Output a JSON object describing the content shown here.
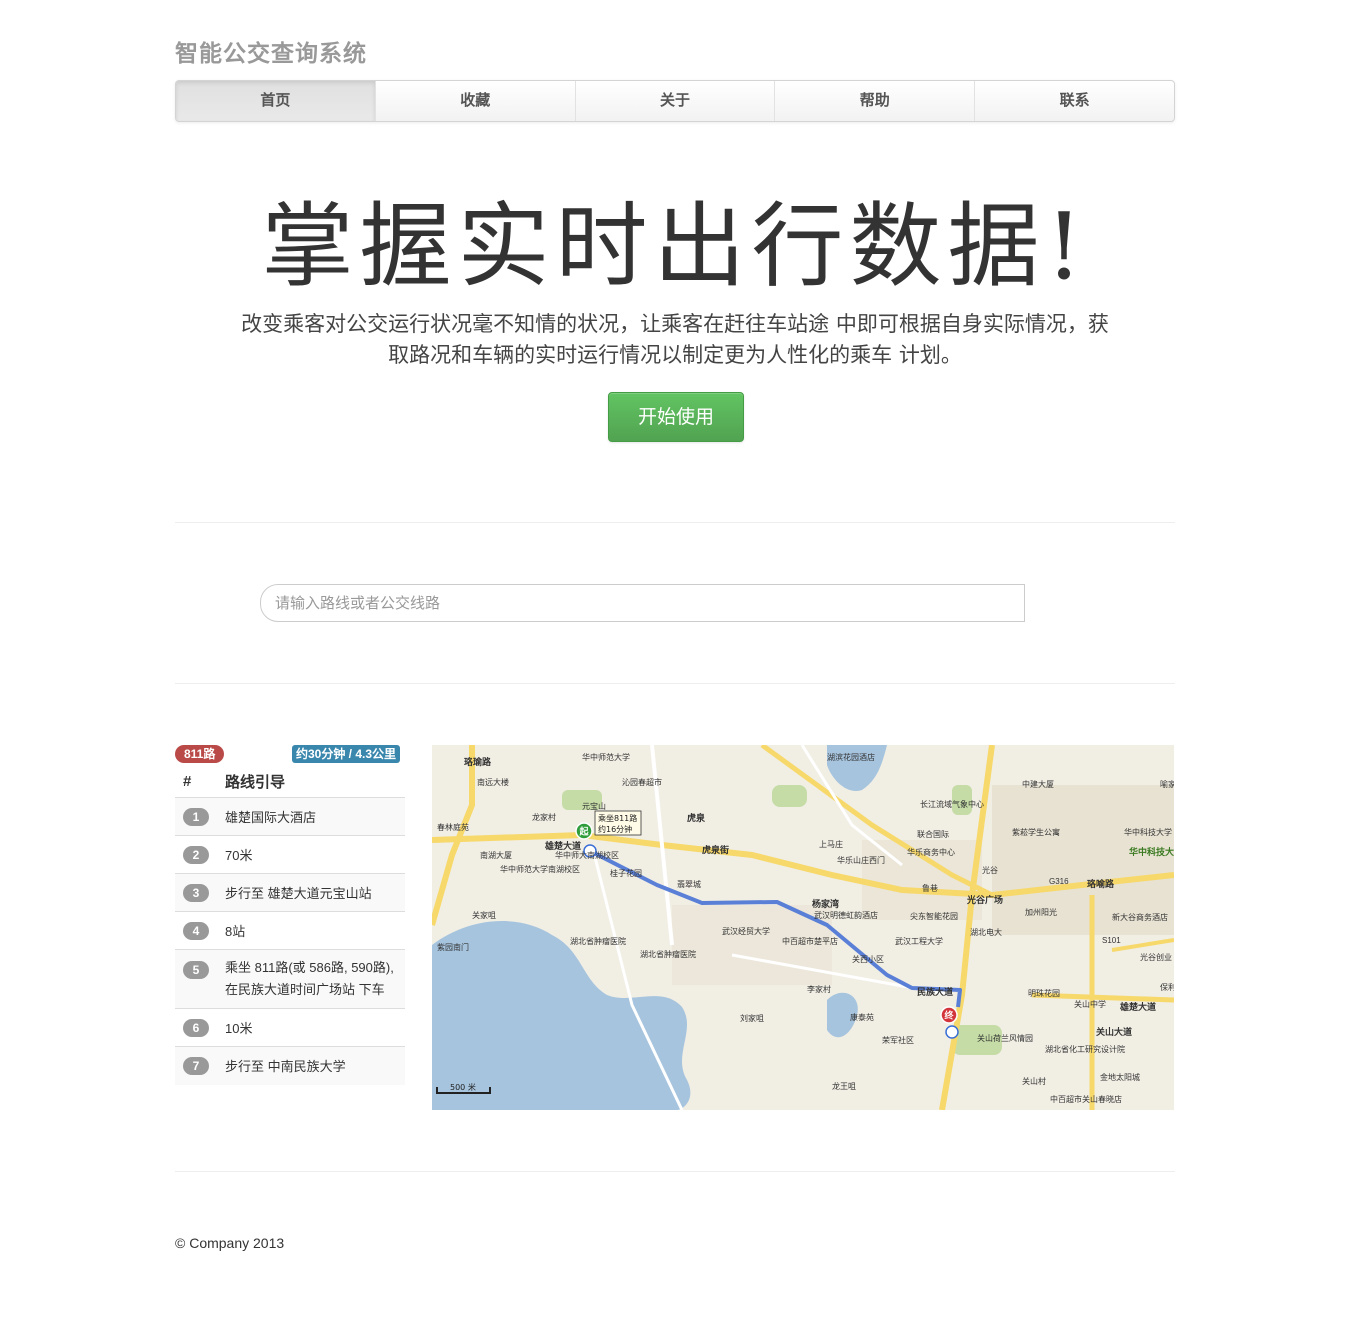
{
  "brand": "智能公交查询系统",
  "nav": {
    "items": [
      "首页",
      "收藏",
      "关于",
      "帮助",
      "联系"
    ],
    "active_index": 0
  },
  "hero": {
    "title": "掌握实时出行数据!",
    "lead_line1": "改变乘客对公交运行状况毫不知情的状况，让乘客在赶往车站途 中即可根据自身实际情况，获",
    "lead_line2": "取路况和车辆的实时运行情况以制定更为人性化的乘车 计划。",
    "start_button": "开始使用"
  },
  "search": {
    "placeholder": "请输入路线或者公交线路",
    "value": ""
  },
  "route": {
    "badge": "811路",
    "time_label": "约30分钟 / 4.3公里",
    "col_num": "#",
    "col_title": "路线引导",
    "steps": [
      {
        "num": "1",
        "text": "雄楚国际大酒店"
      },
      {
        "num": "2",
        "text": "70米"
      },
      {
        "num": "3",
        "text": "步行至 雄楚大道元宝山站"
      },
      {
        "num": "4",
        "text": "8站"
      },
      {
        "num": "5",
        "text": "乘坐 811路(或 586路, 590路), 在民族大道时间广场站 下车"
      },
      {
        "num": "6",
        "text": "10米"
      },
      {
        "num": "7",
        "text": "步行至 中南民族大学"
      }
    ]
  },
  "map": {
    "callout_line1": "乘坐811路",
    "callout_line2": "约16分钟",
    "start_marker": "起",
    "end_marker": "终",
    "scale": "500 米",
    "labels": [
      "华中师范大学",
      "南远大楼",
      "沁园春超市",
      "虎泉",
      "湖滨花园酒店",
      "中建大厦",
      "喻家",
      "华中科技大学",
      "华中科技大",
      "春林庭苑",
      "龙家村",
      "元宝山",
      "南湖大厦",
      "华中师大南湖校区",
      "华中师范大学南湖校区",
      "桂子花园",
      "翡翠城",
      "杨家湾",
      "武汉明德虹韵酒店",
      "武汉经贸大学",
      "中百超市楚平店",
      "关西小区",
      "武汉工程大学",
      "湖北电大",
      "光谷广场",
      "光谷",
      "鲁巷",
      "尖东智能花园",
      "华乐山庄西门",
      "华乐商务中心",
      "联合国际",
      "长江流域气象中心",
      "紫菘学生公寓",
      "加州阳光",
      "新大谷商务酒店",
      "光谷创业",
      "关家咀",
      "紫园南门",
      "湖北省肿瘤医院",
      "湖北省肿瘤医院",
      "李家村",
      "刘家咀",
      "康泰苑",
      "荣军社区",
      "关山荷兰风情园",
      "湖北省化工研究设计院",
      "明珠花园",
      "关山中学",
      "关山村",
      "金地太阳城",
      "中百超市关山春晓店",
      "龙王咀",
      "上马庄",
      "雄楚大道",
      "雄楚大道",
      "虎泉街",
      "关山大道",
      "珞喻路",
      "保利",
      "S101",
      "G316",
      "珞瑜路",
      "民族大道"
    ]
  },
  "colors": {
    "accent_green": "#5bb75b",
    "badge_red": "#b94a48",
    "label_blue": "#3a87ad",
    "route_line": "#5a7fd6",
    "lake": "#a6c4de"
  },
  "footer": "© Company 2013"
}
